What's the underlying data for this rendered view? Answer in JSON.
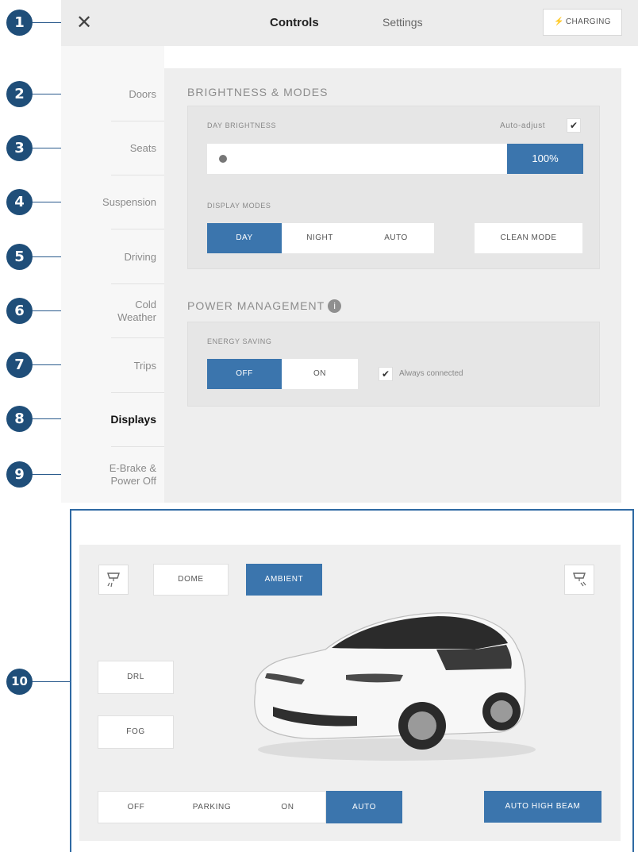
{
  "callouts": [
    "1",
    "2",
    "3",
    "4",
    "5",
    "6",
    "7",
    "8",
    "9",
    "10"
  ],
  "header": {
    "close_icon": "close-icon",
    "close_glyph": "✕",
    "tab_controls": "Controls",
    "tab_settings": "Settings",
    "charging_label": "CHARGING",
    "charging_icon": "⚡"
  },
  "sidebar": {
    "items": [
      {
        "label": "Doors"
      },
      {
        "label": "Seats"
      },
      {
        "label": "Suspension"
      },
      {
        "label": "Driving"
      },
      {
        "label": "Cold Weather"
      },
      {
        "label": "Trips"
      },
      {
        "label": "Displays"
      },
      {
        "label": "E-Brake & Power Off"
      }
    ],
    "active": "Displays"
  },
  "brightness": {
    "section_title": "BRIGHTNESS & MODES",
    "day_brightness_label": "DAY BRIGHTNESS",
    "auto_adjust_label": "Auto-adjust",
    "auto_adjust_checked": true,
    "brightness_value": "100%",
    "display_modes_label": "DISPLAY MODES",
    "modes": [
      "DAY",
      "NIGHT",
      "AUTO"
    ],
    "selected_mode": "DAY",
    "clean_mode_label": "CLEAN MODE"
  },
  "power": {
    "section_title": "POWER MANAGEMENT",
    "info_glyph": "i",
    "energy_saving_label": "ENERGY SAVING",
    "options": [
      "OFF",
      "ON"
    ],
    "selected": "OFF",
    "always_connected_label": "Always connected",
    "always_connected_checked": true
  },
  "lighting": {
    "dome_label": "DOME",
    "ambient_label": "AMBIENT",
    "ambient_selected": true,
    "drl_label": "DRL",
    "fog_label": "FOG",
    "headlight_modes": [
      "OFF",
      "PARKING",
      "ON",
      "AUTO"
    ],
    "selected_headlight": "AUTO",
    "auto_high_beam_label": "AUTO HIGH BEAM"
  },
  "colors": {
    "accent": "#3b75ad",
    "callout": "#1f4e79",
    "frame": "#2f6aa3"
  }
}
